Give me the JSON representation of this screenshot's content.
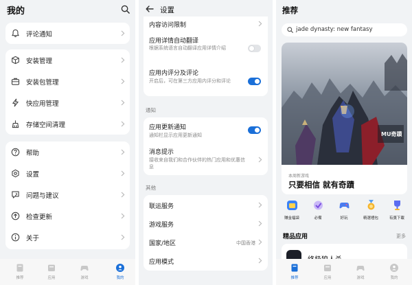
{
  "me": {
    "title": "我的",
    "group1": [
      {
        "label": "评论通知",
        "icon": "bell-icon"
      }
    ],
    "group2": [
      {
        "label": "安装管理",
        "icon": "package-icon"
      },
      {
        "label": "安装包管理",
        "icon": "briefcase-icon"
      },
      {
        "label": "快应用管理",
        "icon": "lightning-icon"
      },
      {
        "label": "存储空间清理",
        "icon": "storage-icon"
      }
    ],
    "group3": [
      {
        "label": "帮助",
        "icon": "help-icon"
      },
      {
        "label": "设置",
        "icon": "gear-icon"
      },
      {
        "label": "问题与建议",
        "icon": "feedback-icon"
      },
      {
        "label": "检查更新",
        "icon": "refresh-icon"
      },
      {
        "label": "关于",
        "icon": "info-icon"
      }
    ],
    "nav": [
      {
        "label": "推荐",
        "icon": "recommend-icon",
        "active": false
      },
      {
        "label": "应用",
        "icon": "apps-icon",
        "active": false
      },
      {
        "label": "游戏",
        "icon": "gamepad-icon",
        "active": false
      },
      {
        "label": "我的",
        "icon": "profile-icon",
        "active": true
      }
    ]
  },
  "settings": {
    "title": "设置",
    "card1": [
      {
        "title": "内容访问限制"
      },
      {
        "title": "应用详情自动翻译",
        "sub": "根据系统语言自动翻译应用详情介绍",
        "toggle": false
      },
      {
        "title": "应用内评分及评论",
        "sub": "开启后，可在第三方应用内评分和评论",
        "toggle": true
      }
    ],
    "section_notify": "通知",
    "card2": [
      {
        "title": "应用更新通知",
        "sub": "通知栏显示应用更新通知",
        "toggle": true
      },
      {
        "title": "消息提示",
        "sub": "接收来自我们和合作伙伴的热门应用和优惠信息"
      }
    ],
    "section_other": "其他",
    "card3": [
      {
        "title": "联运服务"
      },
      {
        "title": "游戏服务"
      },
      {
        "title": "国家/地区",
        "value": "中国香港"
      },
      {
        "title": "应用模式"
      }
    ]
  },
  "recommend": {
    "title": "推荐",
    "search_text": "jade dynasty: new fantasy",
    "banner_tag": "本周新游戏",
    "banner_text": "只要相信 就有奇蹟",
    "banner_logo": "MU奇蹟",
    "categories": [
      {
        "label": "赚金福袋",
        "color": "#3b82f6"
      },
      {
        "label": "必備",
        "color": "#9b6df0"
      },
      {
        "label": "好玩",
        "color": "#4a7cf0"
      },
      {
        "label": "精選禮包",
        "color": "#f0a020"
      },
      {
        "label": "有獎下載",
        "color": "#5a6cf0"
      }
    ],
    "featured_title": "精品应用",
    "featured_more": "更多",
    "featured_app": "终极狼人杀",
    "nav": [
      {
        "label": "推荐",
        "icon": "recommend-icon",
        "active": true
      },
      {
        "label": "应用",
        "icon": "apps-icon",
        "active": false
      },
      {
        "label": "游戏",
        "icon": "gamepad-icon",
        "active": false
      },
      {
        "label": "我的",
        "icon": "profile-icon",
        "active": false
      }
    ]
  },
  "colors": {
    "accent": "#1a6fd8",
    "background": "#f1f3f5",
    "card": "#ffffff"
  }
}
